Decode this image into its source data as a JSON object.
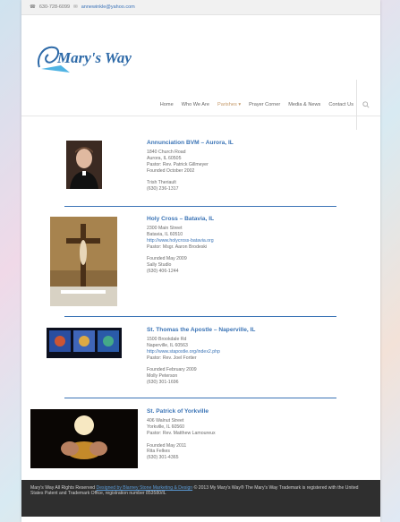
{
  "topbar": {
    "phone": "630-728-6099",
    "email": "annewinkle@yahoo.com"
  },
  "logo": {
    "text": "Mary's Way"
  },
  "nav": {
    "items": [
      "Home",
      "Who We Are",
      "Parishes",
      "Prayer Corner",
      "Media & News",
      "Contact Us"
    ]
  },
  "parishes": [
    {
      "title": "Annunciation BVM – Aurora, IL",
      "lines": [
        "1840 Church Road",
        "Aurora, IL 60505",
        "Pastor: Rev. Patrick Gillmeyer",
        "Founded October 2002"
      ],
      "lines2": [
        "Trish Theriault",
        "(630) 236-1317"
      ]
    },
    {
      "title": "Holy Cross – Batavia, IL",
      "lines": [
        "2300 Main Street",
        "Batavia, IL 60510"
      ],
      "link": "http://www.holycross-batavia.org",
      "lines_after_link": [
        "Pastor:  Msgr. Aaron Brodeski"
      ],
      "lines2": [
        "Founded May 2009",
        "Sally Studlo",
        "(630) 406-1244"
      ]
    },
    {
      "title": "St. Thomas the Apostle – Naperville, IL",
      "lines": [
        "1500 Brookdale Rd",
        "Naperville, IL 60563"
      ],
      "link": "http://www.stapostle.org/index2.php",
      "lines_after_link": [
        "Pastor: Rev. Joel Fortier"
      ],
      "lines2": [
        "Founded February 2009",
        "Molly Peterson",
        "(630) 301-1696"
      ]
    },
    {
      "title": "St. Patrick of Yorkville",
      "lines": [
        "406 Walnut Street",
        "Yorkville, IL 60560",
        "Pastor: Rev. Matthew Lamoureux"
      ],
      "lines2": [
        "Founded May 2011",
        "Rita Felkes",
        "(630) 301-4365"
      ]
    }
  ],
  "footer": {
    "text1": "Mary's Way All Rights Reserved",
    "designed_by": "Designed by Blarney Stone Marketing & Design",
    "text2": "© 2013 My Mary's Way® The Mary's Way Trademark is registered with the United States Patent and Trademark Office, registration number 853580/IL"
  },
  "colors": {
    "accent": "#3b74b6",
    "active_nav": "#c59a6a",
    "footer_bg": "#2f2f2f"
  }
}
